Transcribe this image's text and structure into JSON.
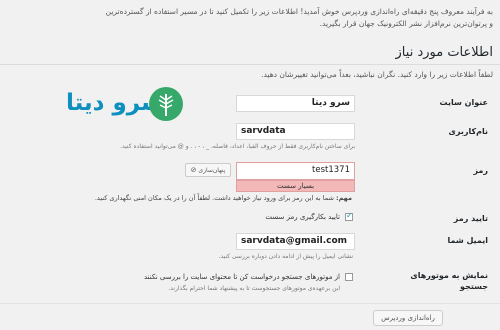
{
  "intro": {
    "line1": "به فرآیند معروف پنج دقیقه‌ای راه‌اندازی وردپرس خوش آمدید! اطلاعات زیر را تکمیل کنید تا در مسیر استفاده از گسترده‌ترین",
    "line2": "و پرتوان‌ترین نرم‌افزار نشر الکترونیک جهان قرار بگیرید."
  },
  "section_title": "اطلاعات مورد نیاز",
  "instructions": "لطفاً اطلاعات زیر را وارد کنید. نگران نباشید، بعداً می‌توانید تغییرشان دهید.",
  "logo": {
    "text": "سرو دیتا"
  },
  "site_title": {
    "label": "عنوان سایت",
    "value": "سرو دیتا"
  },
  "username": {
    "label": "نام‌کاربری",
    "value": "sarvdata",
    "hint": "برای ساختن نام‌کاربری فقط از حروف الفبا، اعداد، فاصله، _ ، - ، . و @ می‌توانید استفاده کنید."
  },
  "password": {
    "label": "رمز",
    "value": "test1371",
    "hide_button": "پنهان‌سازی",
    "strength": "بسیار سست",
    "important_label": "مهم:",
    "important_text": "شما به این رمز برای ورود نیاز خواهید داشت. لطفاً آن را در یک مکان امنی نگهداری کنید."
  },
  "confirm_password": {
    "label": "تایید رمز",
    "checkbox_label": "تایید بکارگیری رمز سست",
    "checked": true
  },
  "email": {
    "label": "ایمیل شما",
    "value": "sarvdata@gmail.com",
    "hint": "نشانی ایمیل را پیش از ادامه دادن دوباره بررسی کنید."
  },
  "search_engines": {
    "label_line1": "نمایش به موتورهای",
    "label_line2": "جستجو",
    "checkbox_label": "از موتورهای جستجو درخواست کن تا محتوای سایت را بررسی نکنند",
    "hint": "این برعهده‌ی موتورهای جستجوست تا به پیشنهاد شما احترام بگذارند.",
    "checked": false
  },
  "submit_button": "راه‌اندازی وردپرس",
  "colors": {
    "logo_blue": "#0d8fbf",
    "logo_green": "#35a86a",
    "strength_bad": "#f3b8b8"
  }
}
